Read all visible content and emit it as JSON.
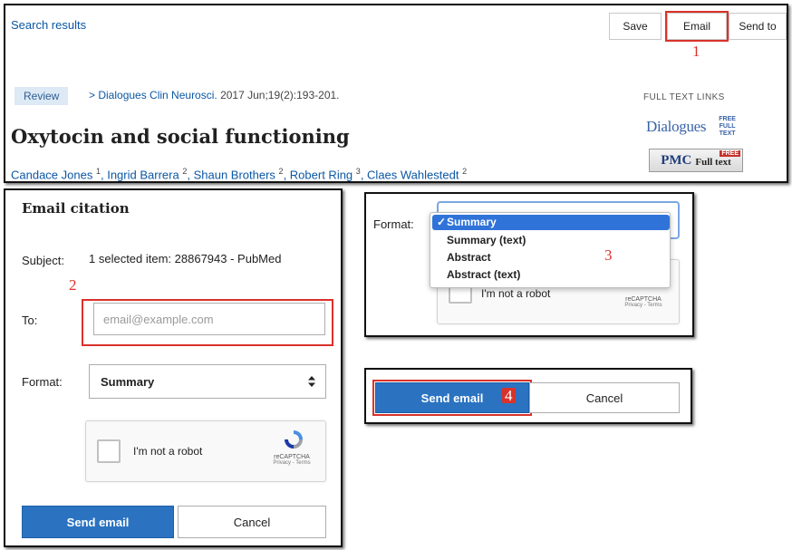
{
  "header": {
    "search_results": "Search results",
    "buttons": {
      "save": "Save",
      "email": "Email",
      "send_to": "Send to"
    },
    "step1": "1"
  },
  "article": {
    "badge": "Review",
    "journal_link": "> Dialogues Clin Neurosci.",
    "journal_meta": " 2017 Jun;19(2):193-201.",
    "title": "Oxytocin and social functioning",
    "authors": [
      {
        "name": "Candace Jones",
        "sup": "1"
      },
      {
        "name": "Ingrid Barrera",
        "sup": "2"
      },
      {
        "name": "Shaun Brothers",
        "sup": "2"
      },
      {
        "name": "Robert Ring",
        "sup": "3"
      },
      {
        "name": "Claes Wahlestedt",
        "sup": "2"
      }
    ],
    "full_text_links": "FULL TEXT LINKS",
    "logo_dialogues": {
      "name": "Dialogues",
      "free_lines": [
        "FREE",
        "FULL",
        "TEXT"
      ]
    },
    "logo_pmc": {
      "name": "PMC",
      "tag": "FREE",
      "text": "Full text"
    }
  },
  "email_form": {
    "title": "Email citation",
    "subject_label": "Subject:",
    "subject_value": "1 selected item: 28867943 - PubMed",
    "step2": "2",
    "to_label": "To:",
    "email_placeholder": "email@example.com",
    "format_label": "Format:",
    "format_value": "Summary",
    "captcha": {
      "label": "I'm not a robot",
      "brand": "reCAPTCHA",
      "links": "Privacy - Terms"
    },
    "send_button": "Send email",
    "cancel_button": "Cancel"
  },
  "format_dropdown": {
    "label": "Format:",
    "check": "✓",
    "options": [
      "Summary",
      "Summary (text)",
      "Abstract",
      "Abstract (text)"
    ],
    "selected": "Summary",
    "step3": "3",
    "captcha": {
      "label": "I'm not a robot",
      "brand": "reCAPTCHA",
      "links": "Privacy - Terms"
    }
  },
  "send_panel": {
    "send_button": "Send email",
    "step4": "4",
    "cancel_button": "Cancel"
  },
  "colors": {
    "accent_blue": "#2b73c1",
    "highlight_red": "#d9322a",
    "link_blue": "#0b57a4"
  }
}
